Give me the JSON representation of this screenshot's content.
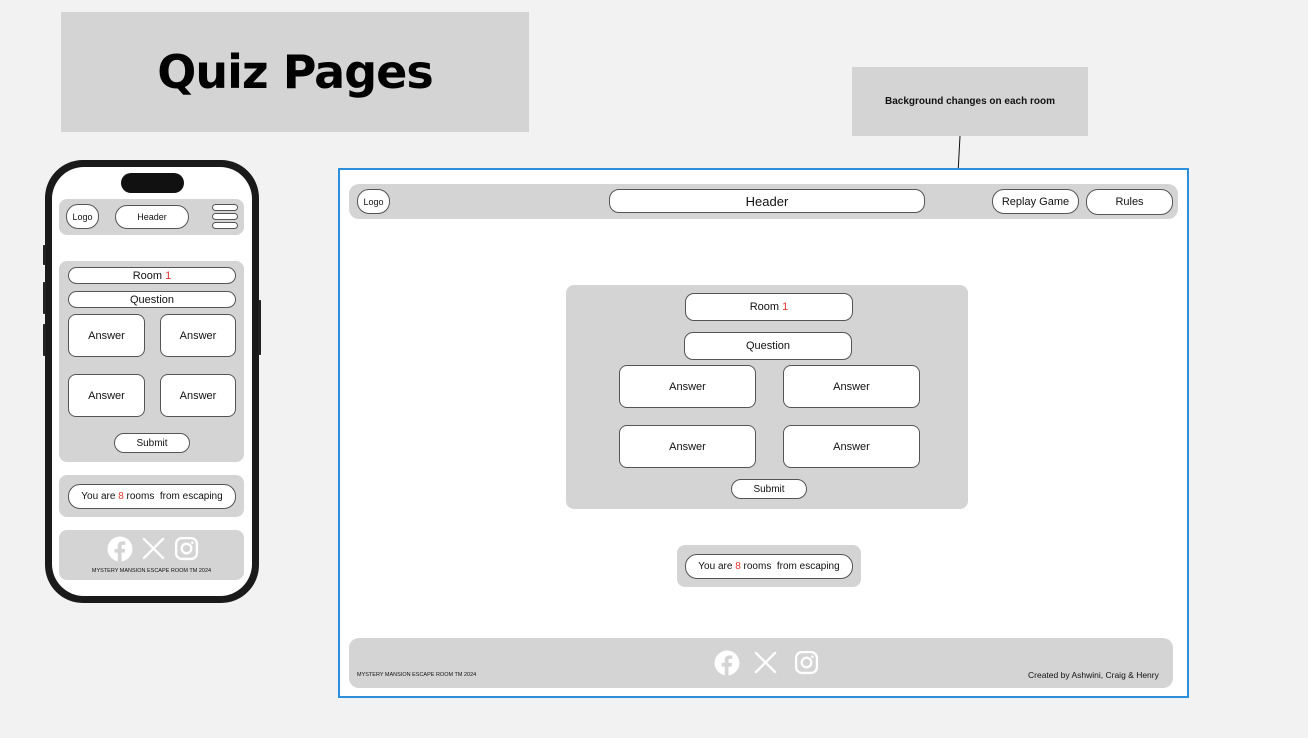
{
  "page": {
    "title": "Quiz Pages"
  },
  "note": {
    "text": "Background changes on each room"
  },
  "mobile": {
    "logo": "Logo",
    "header": "Header",
    "room_label": "Room",
    "room_number": "1",
    "question": "Question",
    "answers": [
      "Answer",
      "Answer",
      "Answer",
      "Answer"
    ],
    "submit": "Submit",
    "progress_prefix": "You are",
    "progress_count": "8",
    "progress_suffix": "rooms  from escaping",
    "footer_text": "MYSTERY MANSION ESCAPE ROOM TM 2024"
  },
  "desktop": {
    "logo": "Logo",
    "header": "Header",
    "replay": "Replay Game",
    "rules": "Rules",
    "room_label": "Room",
    "room_number": "1",
    "question": "Question",
    "answers": [
      "Answer",
      "Answer",
      "Answer",
      "Answer"
    ],
    "submit": "Submit",
    "progress_prefix": "You are",
    "progress_count": "8",
    "progress_suffix": "rooms  from escaping",
    "footer_left": "MYSTERY MANSION ESCAPE ROOM TM 2024",
    "footer_right": "Created by Ashwini, Craig & Henry"
  },
  "icons": [
    "facebook-icon",
    "x-icon",
    "instagram-icon",
    "hamburger-menu-icon"
  ],
  "colors": {
    "accent": "#e0352b",
    "frame": "#2d8fdc",
    "panel": "#d4d4d4"
  }
}
